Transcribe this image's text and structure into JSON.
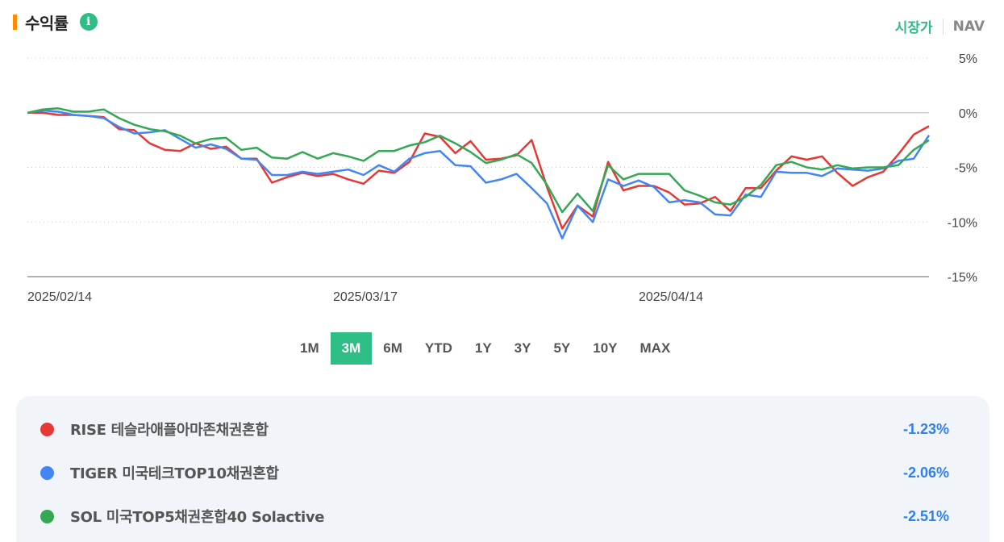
{
  "header": {
    "title": "수익률",
    "info_icon": "i"
  },
  "price_toggle": {
    "market": "시장가",
    "nav": "NAV",
    "active": "market"
  },
  "colors": {
    "accent": "#2ebd85",
    "title_marker": "#ff8c00",
    "negative_return": "#2f7ff0"
  },
  "periods": [
    {
      "label": "1M",
      "active": false
    },
    {
      "label": "3M",
      "active": true
    },
    {
      "label": "6M",
      "active": false
    },
    {
      "label": "YTD",
      "active": false
    },
    {
      "label": "1Y",
      "active": false
    },
    {
      "label": "3Y",
      "active": false
    },
    {
      "label": "5Y",
      "active": false
    },
    {
      "label": "10Y",
      "active": false
    },
    {
      "label": "MAX",
      "active": false
    }
  ],
  "chart_data": {
    "type": "line",
    "xlabel": "",
    "ylabel": "",
    "ylim": [
      -15,
      5
    ],
    "y_ticks": [
      5,
      0,
      -5,
      -10,
      -15
    ],
    "y_tick_labels": [
      "5%",
      "0%",
      "-5%",
      "-10%",
      "-15%"
    ],
    "x_tick_labels": [
      "2025/02/14",
      "2025/03/17",
      "2025/04/14"
    ],
    "x_tick_index": [
      0,
      20,
      40
    ],
    "point_count": 60,
    "grid": "dotted horizontal",
    "series": [
      {
        "name": "RISE 테슬라애플아마존채권혼합",
        "color": "#e53935",
        "values": [
          0,
          0,
          -0.2,
          -0.2,
          -0.3,
          -0.4,
          -1.5,
          -1.6,
          -2.8,
          -3.4,
          -3.5,
          -2.8,
          -3.3,
          -3.1,
          -4.2,
          -4.2,
          -6.4,
          -5.9,
          -5.5,
          -5.8,
          -5.6,
          -6.1,
          -6.5,
          -5.3,
          -5.5,
          -4.5,
          -1.9,
          -2.2,
          -3.7,
          -2.6,
          -4.3,
          -4.2,
          -3.9,
          -2.5,
          -6.8,
          -10.6,
          -8.5,
          -9.5,
          -4.5,
          -7.1,
          -6.7,
          -6.7,
          -7.3,
          -8.4,
          -8.3,
          -7.7,
          -9.0,
          -6.9,
          -6.9,
          -5.3,
          -4.0,
          -4.3,
          -4.0,
          -5.5,
          -6.7,
          -5.9,
          -5.4,
          -3.8,
          -2.0,
          -1.23
        ]
      },
      {
        "name": "TIGER 미국테크TOP10채권혼합",
        "color": "#4285f4",
        "values": [
          0,
          0.2,
          0.1,
          -0.2,
          -0.3,
          -0.5,
          -1.3,
          -1.9,
          -1.8,
          -1.6,
          -2.4,
          -3.2,
          -2.9,
          -3.3,
          -4.2,
          -4.3,
          -5.7,
          -5.7,
          -5.4,
          -5.6,
          -5.4,
          -5.2,
          -5.7,
          -4.8,
          -5.4,
          -4.2,
          -3.7,
          -3.5,
          -4.8,
          -4.9,
          -6.4,
          -6.1,
          -5.6,
          -6.9,
          -8.3,
          -11.5,
          -8.5,
          -10.0,
          -6.1,
          -6.7,
          -6.2,
          -6.8,
          -8.2,
          -8.0,
          -8.2,
          -9.3,
          -9.4,
          -7.5,
          -7.7,
          -5.4,
          -5.5,
          -5.5,
          -5.8,
          -5.1,
          -5.2,
          -5.3,
          -5.1,
          -4.4,
          -4.2,
          -2.06
        ]
      },
      {
        "name": "SOL 미국TOP5채권혼합40 Solactive",
        "color": "#34a853",
        "values": [
          0,
          0.3,
          0.4,
          0.1,
          0.1,
          0.3,
          -0.5,
          -1.1,
          -1.5,
          -1.7,
          -2.1,
          -2.8,
          -2.4,
          -2.3,
          -3.4,
          -3.2,
          -4.1,
          -4.2,
          -3.6,
          -4.2,
          -3.7,
          -4.0,
          -4.4,
          -3.5,
          -3.5,
          -3.0,
          -2.7,
          -2.1,
          -2.8,
          -3.6,
          -4.6,
          -4.3,
          -3.8,
          -4.6,
          -6.6,
          -9.1,
          -7.4,
          -9.0,
          -4.8,
          -6.1,
          -5.6,
          -5.6,
          -5.6,
          -7.1,
          -7.6,
          -8.2,
          -8.4,
          -7.7,
          -6.6,
          -4.8,
          -4.5,
          -5.0,
          -5.2,
          -4.8,
          -5.1,
          -5.0,
          -5.0,
          -4.8,
          -3.4,
          -2.51
        ]
      }
    ]
  },
  "legend": [
    {
      "name": "RISE 테슬라애플아마존채권혼합",
      "return": "-1.23%",
      "color": "#e53935"
    },
    {
      "name": "TIGER 미국테크TOP10채권혼합",
      "return": "-2.06%",
      "color": "#4285f4"
    },
    {
      "name": "SOL 미국TOP5채권혼합40 Solactive",
      "return": "-2.51%",
      "color": "#34a853"
    }
  ]
}
